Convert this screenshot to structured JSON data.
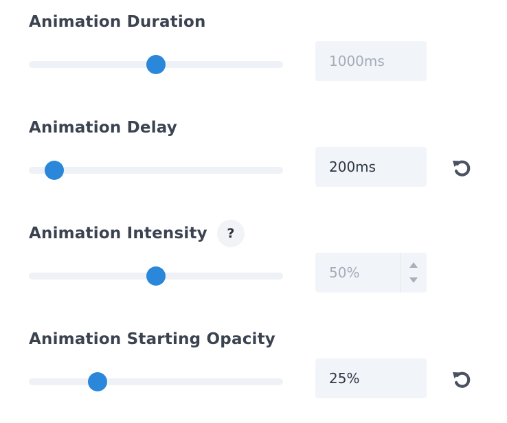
{
  "settings": [
    {
      "label": "Animation Duration",
      "value": "1000ms",
      "value_state": "default",
      "slider_fraction": 0.5,
      "has_help": false,
      "has_reset": false,
      "has_spinner": false
    },
    {
      "label": "Animation Delay",
      "value": "200ms",
      "value_state": "modified",
      "slider_fraction": 0.1,
      "has_help": false,
      "has_reset": true,
      "has_spinner": false
    },
    {
      "label": "Animation Intensity",
      "value": "50%",
      "value_state": "default",
      "slider_fraction": 0.5,
      "has_help": true,
      "help_label": "?",
      "has_reset": false,
      "has_spinner": true
    },
    {
      "label": "Animation Starting Opacity",
      "value": "25%",
      "value_state": "modified",
      "slider_fraction": 0.27,
      "has_help": false,
      "has_reset": true,
      "has_spinner": false
    }
  ],
  "icons": {
    "reset": "reset-icon",
    "help": "help-icon",
    "spin_up": "chevron-up-icon",
    "spin_down": "chevron-down-icon"
  },
  "colors": {
    "accent": "#2b87da",
    "track": "#eef1f6",
    "field_background": "#f1f4f9",
    "label_text": "#3b4351",
    "muted_value": "#a5acb8",
    "icon": "#4a5160"
  }
}
